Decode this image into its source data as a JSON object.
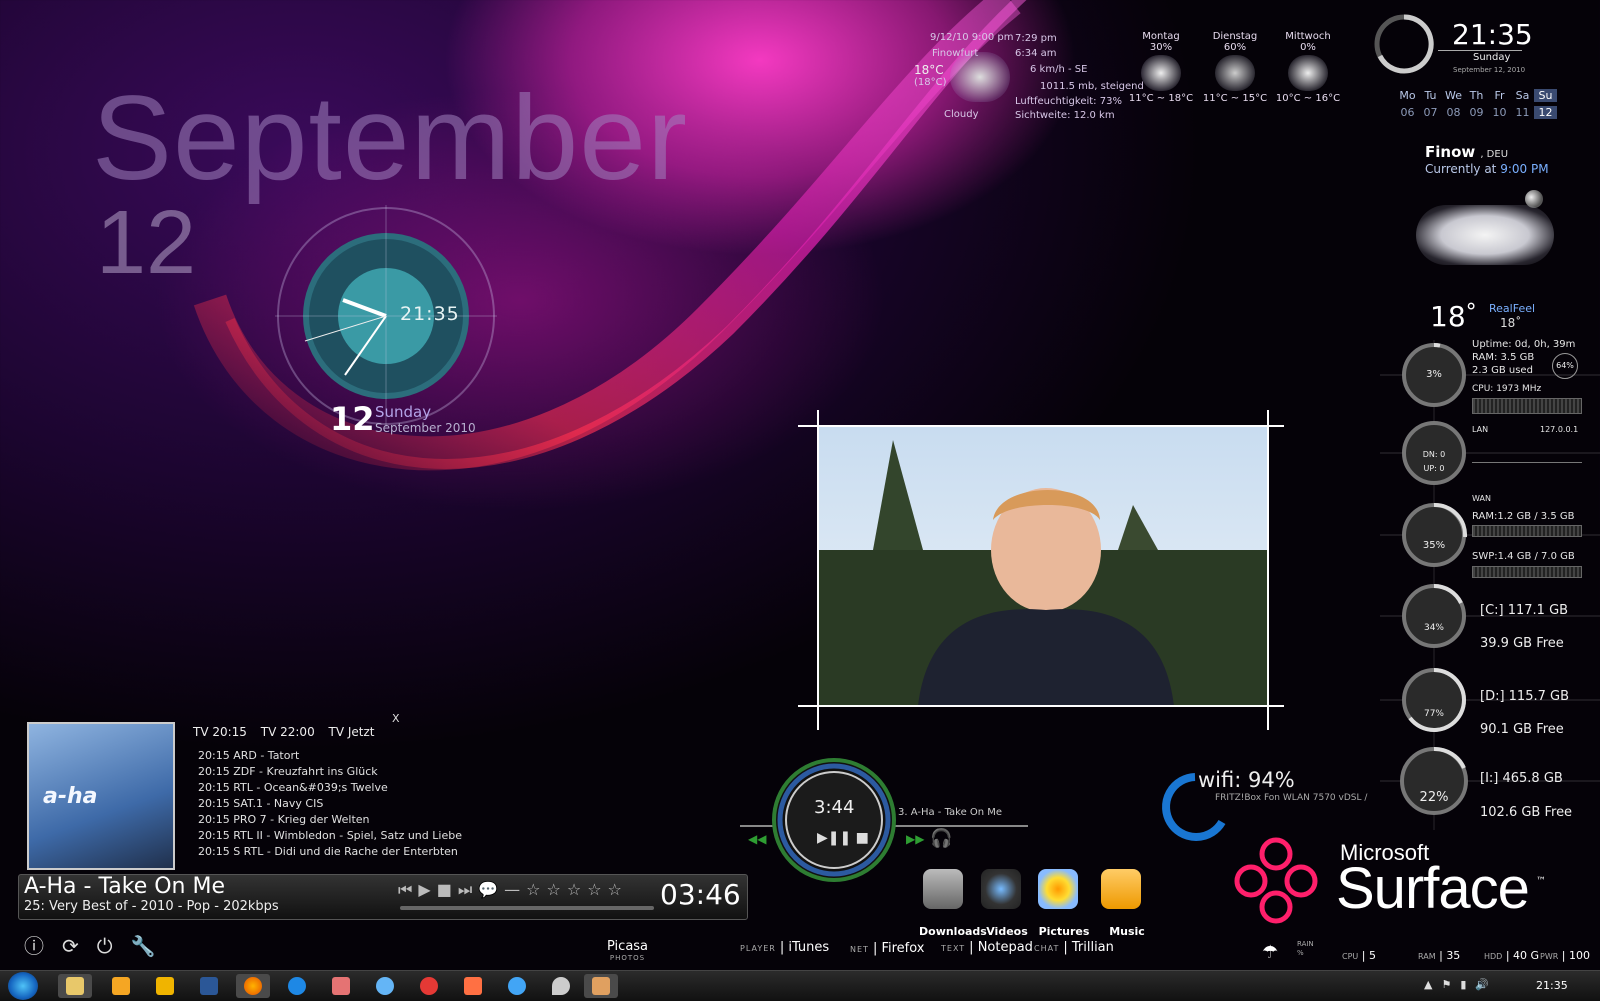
{
  "date_big": {
    "month": "September",
    "day": "12"
  },
  "clock": {
    "time": "21:35",
    "day_num": "12",
    "weekday": "Sunday",
    "month_year": "September 2010"
  },
  "top_weather": {
    "updated": "9/12/10 9:00 pm",
    "location": "Finowfurt",
    "temp": "18°C",
    "feels": "(18°C)",
    "condition": "Cloudy",
    "sunset": "7:29 pm",
    "sunrise": "6:34 am",
    "wind": "6 km/h - SE",
    "pressure": "1011.5 mb, steigend",
    "humidity": "Luftfeuchtigkeit: 73%",
    "visibility": "Sichtweite: 12.0 km",
    "forecast": [
      {
        "day": "Montag",
        "pct": "30%",
        "range": "11°C ~ 18°C"
      },
      {
        "day": "Dienstag",
        "pct": "60%",
        "range": "11°C ~ 15°C"
      },
      {
        "day": "Mittwoch",
        "pct": "0%",
        "range": "10°C ~ 16°C"
      }
    ]
  },
  "top_clock": {
    "time": "21:35",
    "weekday": "Sunday",
    "date": "September 12, 2010"
  },
  "calendar": {
    "heads": [
      "Mo",
      "Tu",
      "We",
      "Th",
      "Fr",
      "Sa",
      "Su"
    ],
    "days": [
      "06",
      "07",
      "08",
      "09",
      "10",
      "11",
      "12"
    ]
  },
  "city_weather": {
    "city": "Finow",
    "country": ", DEU",
    "currently": "Currently at",
    "time": "9:00 PM",
    "temp": "18",
    "deg": "°",
    "realfeel_label": "RealFeel",
    "realfeel": "18˚"
  },
  "system": {
    "uptime": "Uptime:  0d, 0h, 39m",
    "ram": "RAM: 3.5 GB",
    "ram_used": "2.3 GB used",
    "ram_pct": "64%",
    "cpu_pct": "3%",
    "cpu_freq": "CPU: 1973 MHz",
    "lan_label": "LAN",
    "lan_ip": "127.0.0.1",
    "dn": "DN: 0",
    "up": "UP: 0",
    "wan_label": "WAN",
    "wan_ram": "RAM:1.2 GB  / 3.5 GB",
    "swp": "SWP:1.4 GB  / 7.0 GB",
    "mem_pct": "35%",
    "drives": [
      {
        "pct": "34%",
        "name": "[C:] 117.1 GB",
        "free": "39.9 GB Free"
      },
      {
        "pct": "77%",
        "name": "[D:] 115.7 GB",
        "free": "90.1 GB Free"
      },
      {
        "pct": "22%",
        "name": "[I:] 465.8 GB",
        "free": "102.6 GB Free"
      }
    ]
  },
  "tv": {
    "tabs": [
      "TV 20:15",
      "TV 22:00",
      "TV Jetzt"
    ],
    "close": "X",
    "listings": [
      "20:15 ARD - Tatort",
      "20:15 ZDF - Kreuzfahrt ins Glück",
      "20:15 RTL - Ocean&#039;s Twelve",
      "20:15 SAT.1 - Navy CIS",
      "20:15 PRO 7 - Krieg der Welten",
      "20:15 RTL II - Wimbledon - Spiel, Satz und Liebe",
      "20:15 S RTL - Didi und die Rache der Enterbten"
    ]
  },
  "player": {
    "track": "A-Ha - Take On Me",
    "album": "25: Very Best of - 2010 - Pop - 202kbps",
    "time": "03:46",
    "album_art_text": "a-ha"
  },
  "mini_player": {
    "time": "3:44",
    "track": "3. A-Ha - Take On Me"
  },
  "wifi": {
    "label": "wifi: 94%",
    "network": "FRITZ!Box Fon WLAN 7570 vDSL /"
  },
  "dock": [
    {
      "label": "Downloads",
      "color": "#8a8a8a"
    },
    {
      "label": "Videos",
      "color": "#3a3a3a"
    },
    {
      "label": "Pictures",
      "color": "#e8c23a"
    },
    {
      "label": "Music",
      "color": "#f0a030"
    }
  ],
  "launchers": [
    {
      "title": "Picasa",
      "sub": "PHOTOS"
    },
    {
      "pre": "PLAYER",
      "name": "iTunes"
    },
    {
      "pre": "NET",
      "name": "Firefox"
    },
    {
      "pre": "TEXT",
      "name": "Notepad"
    },
    {
      "pre": "CHAT",
      "name": "Trillian"
    }
  ],
  "brand": {
    "line1": "Microsoft",
    "line2": "Surface",
    "tm": "™"
  },
  "stats": {
    "rain_label": "RAIN",
    "rain_unit": "%",
    "cpu_label": "CPU",
    "cpu": "5",
    "ram_label": "RAM",
    "ram": "35",
    "hdd_label": "HDD",
    "hdd": "40 G",
    "pwr_label": "PWR",
    "pwr": "100"
  },
  "taskbar": {
    "time": "21:35"
  }
}
